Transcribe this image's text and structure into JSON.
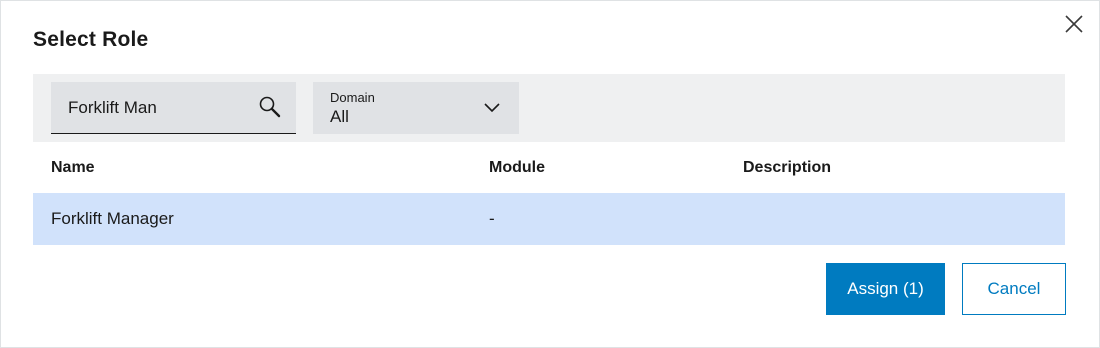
{
  "dialog": {
    "title": "Select Role",
    "close_icon": "close-icon"
  },
  "filters": {
    "search": {
      "value": "Forklift Man",
      "icon": "search-icon"
    },
    "domain": {
      "label": "Domain",
      "value": "All",
      "icon": "chevron-down-icon"
    }
  },
  "table": {
    "columns": [
      "Name",
      "Module",
      "Description"
    ],
    "rows": [
      {
        "name": "Forklift Manager",
        "module": "-",
        "description": "",
        "selected": true
      }
    ]
  },
  "actions": {
    "assign_label": "Assign (1)",
    "cancel_label": "Cancel"
  },
  "colors": {
    "primary": "#007bc0",
    "selected_row": "#d1e2fb",
    "filter_bar": "#eff0f1",
    "field_bg": "#e0e2e5"
  }
}
